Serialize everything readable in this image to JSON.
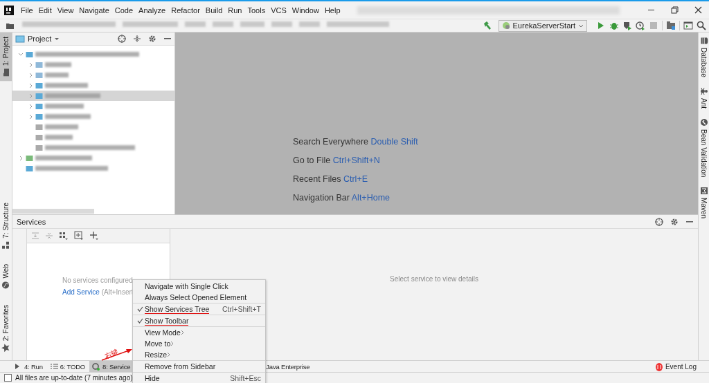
{
  "menu_bar": {
    "items": [
      "File",
      "Edit",
      "View",
      "Navigate",
      "Code",
      "Analyze",
      "Refactor",
      "Build",
      "Run",
      "Tools",
      "VCS",
      "Window",
      "Help"
    ]
  },
  "toolbar": {
    "run_configuration": "EurekaServerStart"
  },
  "left_tool_tabs": [
    {
      "label": "1: Project",
      "selected": true
    },
    {
      "label": "7: Structure",
      "selected": false
    },
    {
      "label": "Web",
      "selected": false
    },
    {
      "label": "2: Favorites",
      "selected": false
    }
  ],
  "right_tool_tabs": [
    {
      "label": "Database"
    },
    {
      "label": "Ant"
    },
    {
      "label": "Bean Validation"
    },
    {
      "label": "Maven"
    }
  ],
  "project_panel": {
    "title": "Project",
    "tree": [
      {
        "kind": "module",
        "expanded": true,
        "selected": false,
        "children": [
          {
            "kind": "folder",
            "expanded": false,
            "selected": false
          },
          {
            "kind": "folder",
            "expanded": false,
            "selected": false
          },
          {
            "kind": "module",
            "expanded": false,
            "selected": false
          },
          {
            "kind": "module",
            "expanded": false,
            "selected": true
          },
          {
            "kind": "module",
            "expanded": false,
            "selected": false
          },
          {
            "kind": "module",
            "expanded": false,
            "selected": false
          },
          {
            "kind": "file",
            "selected": false
          },
          {
            "kind": "file",
            "selected": false
          },
          {
            "kind": "file",
            "selected": false
          }
        ]
      },
      {
        "kind": "library",
        "expanded": false,
        "selected": false
      },
      {
        "kind": "scratches",
        "selected": false
      }
    ]
  },
  "editor_hints": [
    {
      "action": "Search Everywhere",
      "shortcut": "Double Shift"
    },
    {
      "action": "Go to File",
      "shortcut": "Ctrl+Shift+N"
    },
    {
      "action": "Recent Files",
      "shortcut": "Ctrl+E"
    },
    {
      "action": "Navigation Bar",
      "shortcut": "Alt+Home"
    }
  ],
  "services_panel": {
    "title": "Services",
    "empty_text": "No services configured",
    "add_link": "Add Service",
    "add_hint": "(Alt+Insert",
    "details_text": "Select service to view details"
  },
  "bottom_tabs": [
    {
      "label": "4: Run",
      "selected": false
    },
    {
      "label": "6: TODO",
      "selected": false
    },
    {
      "label": "8: Service",
      "selected": true
    },
    {
      "label": "Java Enterprise",
      "selected": false
    }
  ],
  "event_log": "Event Log",
  "status_bar": {
    "text": "All files are up-to-date (7 minutes ago)"
  },
  "context_menu": {
    "items": [
      {
        "kind": "item",
        "label": "Navigate with Single Click",
        "checked": false
      },
      {
        "kind": "item",
        "label": "Always Select Opened Element",
        "checked": false
      },
      {
        "kind": "separator"
      },
      {
        "kind": "item",
        "label": "Show Services Tree",
        "checked": true,
        "underlined": true,
        "shortcut": "Ctrl+Shift+T"
      },
      {
        "kind": "separator"
      },
      {
        "kind": "item",
        "label": "Show Toolbar",
        "checked": true,
        "underlined": true
      },
      {
        "kind": "separator"
      },
      {
        "kind": "submenu",
        "label": "View Mode"
      },
      {
        "kind": "submenu",
        "label": "Move to"
      },
      {
        "kind": "submenu",
        "label": "Resize"
      },
      {
        "kind": "separator"
      },
      {
        "kind": "item",
        "label": "Remove from Sidebar",
        "checked": false
      },
      {
        "kind": "separator"
      },
      {
        "kind": "item",
        "label": "Hide",
        "checked": false,
        "shortcut": "Shift+Esc"
      }
    ]
  },
  "annotation": {
    "text": "右键"
  }
}
